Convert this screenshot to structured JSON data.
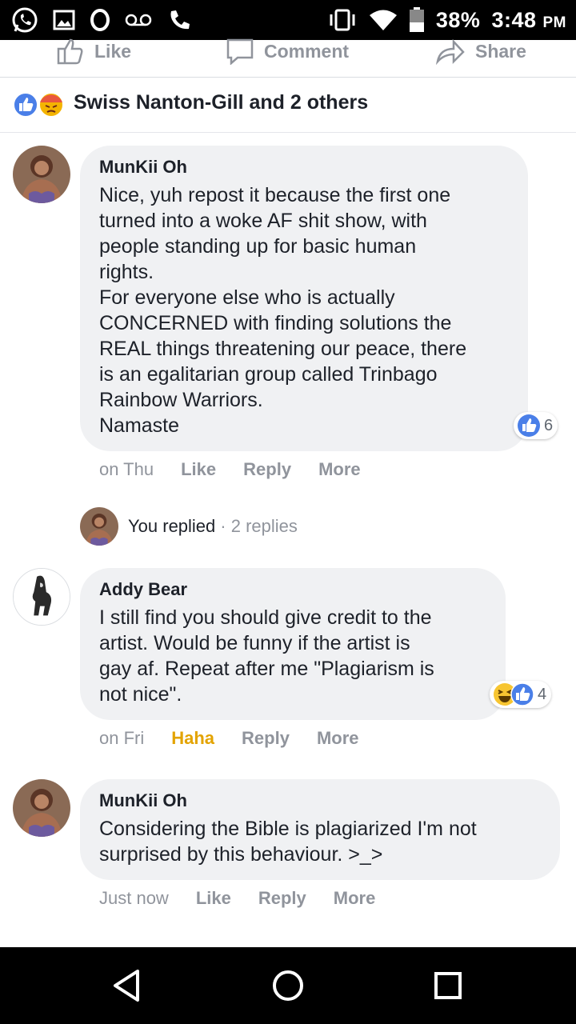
{
  "status_bar": {
    "battery": "38%",
    "time": "3:48",
    "ampm": "PM",
    "icons": [
      "whatsapp-icon",
      "gallery-icon",
      "opera-icon",
      "voicemail-icon",
      "phone-icon",
      "vibrate-icon",
      "wifi-icon",
      "battery-icon"
    ]
  },
  "actions": {
    "like": "Like",
    "comment": "Comment",
    "share": "Share"
  },
  "reactions": {
    "summary": "Swiss Nanton-Gill and 2 others",
    "icons": [
      "like-reaction-icon",
      "angry-reaction-icon"
    ]
  },
  "comments": [
    {
      "author": "MunKii Oh",
      "text": "Nice, yuh repost it because the first one\nturned into a woke AF shit show, with\npeople standing up for basic human\nrights.\nFor everyone else who is actually\nCONCERNED with finding solutions the\nREAL things threatening our peace, there\nis an egalitarian group called Trinbago\nRainbow Warriors.\nNamaste",
      "time": "on Thu",
      "action_like": "Like",
      "action_reply": "Reply",
      "action_more": "More",
      "reaction_count": "6"
    },
    {
      "author": "Addy Bear",
      "text": "I still find you should give credit to the\nartist. Would be funny if the artist is\ngay af. Repeat after me \"Plagiarism is\nnot nice\".",
      "time": "on Fri",
      "action_like": "Haha",
      "action_reply": "Reply",
      "action_more": "More",
      "reaction_count": "4"
    },
    {
      "author": "MunKii Oh",
      "text": "Considering the Bible is plagiarized I'm not\nsurprised by this behaviour. >_>",
      "time": "Just now",
      "action_like": "Like",
      "action_reply": "Reply",
      "action_more": "More"
    }
  ],
  "replies_summary": {
    "you": "You replied",
    "count": "· 2 replies"
  },
  "colors": {
    "like_blue": "#4a7fe8",
    "haha_yellow": "#e3a300",
    "bubble_bg": "#f0f1f3",
    "meta_gray": "#90949c"
  }
}
